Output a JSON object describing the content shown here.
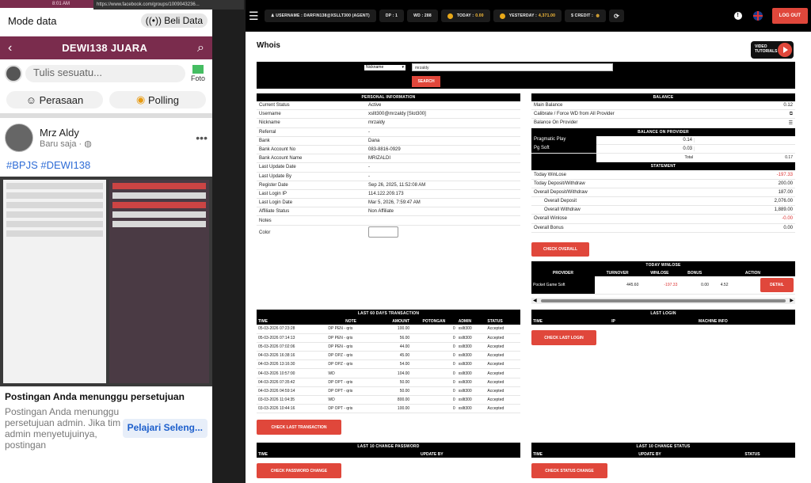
{
  "phone": {
    "status_url": "https://www.facebook.com/groups/1009043236...",
    "status_time": "8:01 AM",
    "mode_label": "Mode data",
    "beli_label": "Beli Data",
    "group_name": "DEWI138 JUARA",
    "write_placeholder": "Tulis sesuatu...",
    "foto_label": "Foto",
    "perasaan_label": "Perasaan",
    "polling_label": "Polling",
    "author": "Mrz Aldy",
    "posted": "Baru saja",
    "tags": "#BPJS #DEWI138",
    "pending_title": "Postingan Anda menunggu persetujuan",
    "pending_body": "Postingan Anda menunggu persetujuan admin. Jika tim admin menyetujuinya, postingan",
    "learn_more": "Pelajari Seleng..."
  },
  "topbar": {
    "username": "USERNAME : DARFIN138@XSLLT300 (AGENT)",
    "dp": "DP : 1",
    "wd": "WD : 288",
    "today_label": "TODAY :",
    "today_value": "0.00",
    "yesterday_label": "YESTERDAY :",
    "yesterday_value": "4,371.00",
    "credit_label": "$ CREDIT :",
    "logout": "LOG OUT"
  },
  "page_title": "Whois",
  "video_label": "VIDEO TUTORIALS",
  "search": {
    "select_value": "Nickname",
    "input_value": "mrzaldy",
    "button": "SEARCH"
  },
  "personal": {
    "header": "PERSONAL INFORMATION",
    "rows": [
      {
        "k": "Current Status",
        "v": "Active"
      },
      {
        "k": "Username",
        "v": "xsllt300@mrzaldy  [Slot300]"
      },
      {
        "k": "Nickname",
        "v": "mrzaldy"
      },
      {
        "k": "Referral",
        "v": "-"
      },
      {
        "k": "Bank",
        "v": "Dana"
      },
      {
        "k": "Bank Account No",
        "v": "083-8816-0929"
      },
      {
        "k": "Bank Account Name",
        "v": "MRIZALDI"
      },
      {
        "k": "Last Update Date",
        "v": "-"
      },
      {
        "k": "Last Update By",
        "v": "-"
      },
      {
        "k": "Register Date",
        "v": "Sep 26, 2025, 11:52:08 AM"
      },
      {
        "k": "Last Login IP",
        "v": "114.122.209.173"
      },
      {
        "k": "Last Login Date",
        "v": "Mar 5, 2026, 7:59:47 AM"
      },
      {
        "k": "Affiliate Status",
        "v": "Non Affiliate"
      },
      {
        "k": "Notes",
        "v": ""
      }
    ],
    "color_label": "Color"
  },
  "balance": {
    "header": "BALANCE",
    "main_label": "Main Balance",
    "main_value": "0.12",
    "calibrate_label": "Calibrate / Force WD from All Provider",
    "on_provider_label": "Balance On Provider"
  },
  "provider_balance": {
    "header": "BALANCE ON PROVIDER",
    "rows": [
      {
        "k": "Pragmatic Play",
        "v": "0.14"
      },
      {
        "k": "Pg Soft",
        "v": "0.03"
      }
    ],
    "total_label": "Total",
    "total_value": "0.17"
  },
  "statement": {
    "header": "STATEMENT",
    "rows": [
      {
        "k": "Today WinLose",
        "v": "-197.33",
        "red": true,
        "indent": false
      },
      {
        "k": "Today Deposit/Withdraw",
        "v": "200.00",
        "red": false,
        "indent": false
      },
      {
        "k": "Overall Deposit/Withdraw",
        "v": "187.00",
        "red": false,
        "indent": false
      },
      {
        "k": "Overall Deposit",
        "v": "2,076.00",
        "red": false,
        "indent": true
      },
      {
        "k": "Overall Withdraw",
        "v": "1,889.00",
        "red": false,
        "indent": true
      },
      {
        "k": "Overall Winlose",
        "v": "-0.00",
        "red": true,
        "indent": false
      },
      {
        "k": "Overall Bonus",
        "v": "0.00",
        "red": false,
        "indent": false
      }
    ],
    "button": "CHECK OVERALL"
  },
  "today_winlose": {
    "header": "TODAY WINLOSE",
    "columns": [
      "PROVIDER",
      "TURNOVER",
      "WINLOSE",
      "BONUS",
      "ACTION"
    ],
    "row": {
      "provider": "Pocket Game Soft",
      "turnover": "445.60",
      "winlose": "-197.33",
      "bonus": "0.00",
      "extra": "4.52"
    },
    "detail": "DETAIL"
  },
  "transactions": {
    "header": "LAST 60 DAYS TRANSACTION",
    "columns": [
      "TIME",
      "NOTE",
      "AMOUNT",
      "POTONGAN",
      "ADMIN",
      "STATUS"
    ],
    "rows": [
      [
        "05-03-2026 07:23:28",
        "DP PEN - qris",
        "100.00",
        "0",
        "xsllt300",
        "Accepted"
      ],
      [
        "05-03-2026 07:14:13",
        "DP PEN - qris",
        "56.00",
        "0",
        "xsllt300",
        "Accepted"
      ],
      [
        "05-03-2026 07:02:06",
        "DP PEN - qris",
        "44.00",
        "0",
        "xsllt300",
        "Accepted"
      ],
      [
        "04-03-2026 16:38:16",
        "DP OPZ - qris",
        "45.00",
        "0",
        "xsllt300",
        "Accepted"
      ],
      [
        "04-03-2026 13:16:30",
        "DP OPZ - qris",
        "54.00",
        "0",
        "xsllt300",
        "Accepted"
      ],
      [
        "04-03-2026 10:57:00",
        "WD",
        "104.00",
        "0",
        "xsllt300",
        "Accepted"
      ],
      [
        "04-03-2026 07:35:42",
        "DP OPT - qris",
        "50.00",
        "0",
        "xsllt300",
        "Accepted"
      ],
      [
        "04-03-2026 04:59:14",
        "DP OPT - qris",
        "50.00",
        "0",
        "xsllt300",
        "Accepted"
      ],
      [
        "03-03-2026 11:04:35",
        "WD",
        "800.00",
        "0",
        "xsllt300",
        "Accepted"
      ],
      [
        "03-03-2026 10:44:16",
        "DP OPT - qris",
        "100.00",
        "0",
        "xsllt300",
        "Accepted"
      ]
    ],
    "button": "CHECK LAST TRANSACTION"
  },
  "last_login": {
    "header": "LAST LOGIN",
    "columns": [
      "TIME",
      "IP",
      "MACHINE INFO"
    ],
    "button": "CHECK LAST LOGIN"
  },
  "change_password": {
    "header": "LAST 10 CHANGE PASSWORD",
    "columns": [
      "TIME",
      "UPDATE BY"
    ],
    "button": "CHECK PASSWORD CHANGE"
  },
  "change_status": {
    "header": "LAST 10 CHANGE STATUS",
    "columns": [
      "TIME",
      "UPDATE BY",
      "STATUS"
    ],
    "button": "CHECK STATUS CHANGE"
  },
  "colors": {
    "accent": "#e0473b",
    "brand": "#7a2c4d"
  }
}
